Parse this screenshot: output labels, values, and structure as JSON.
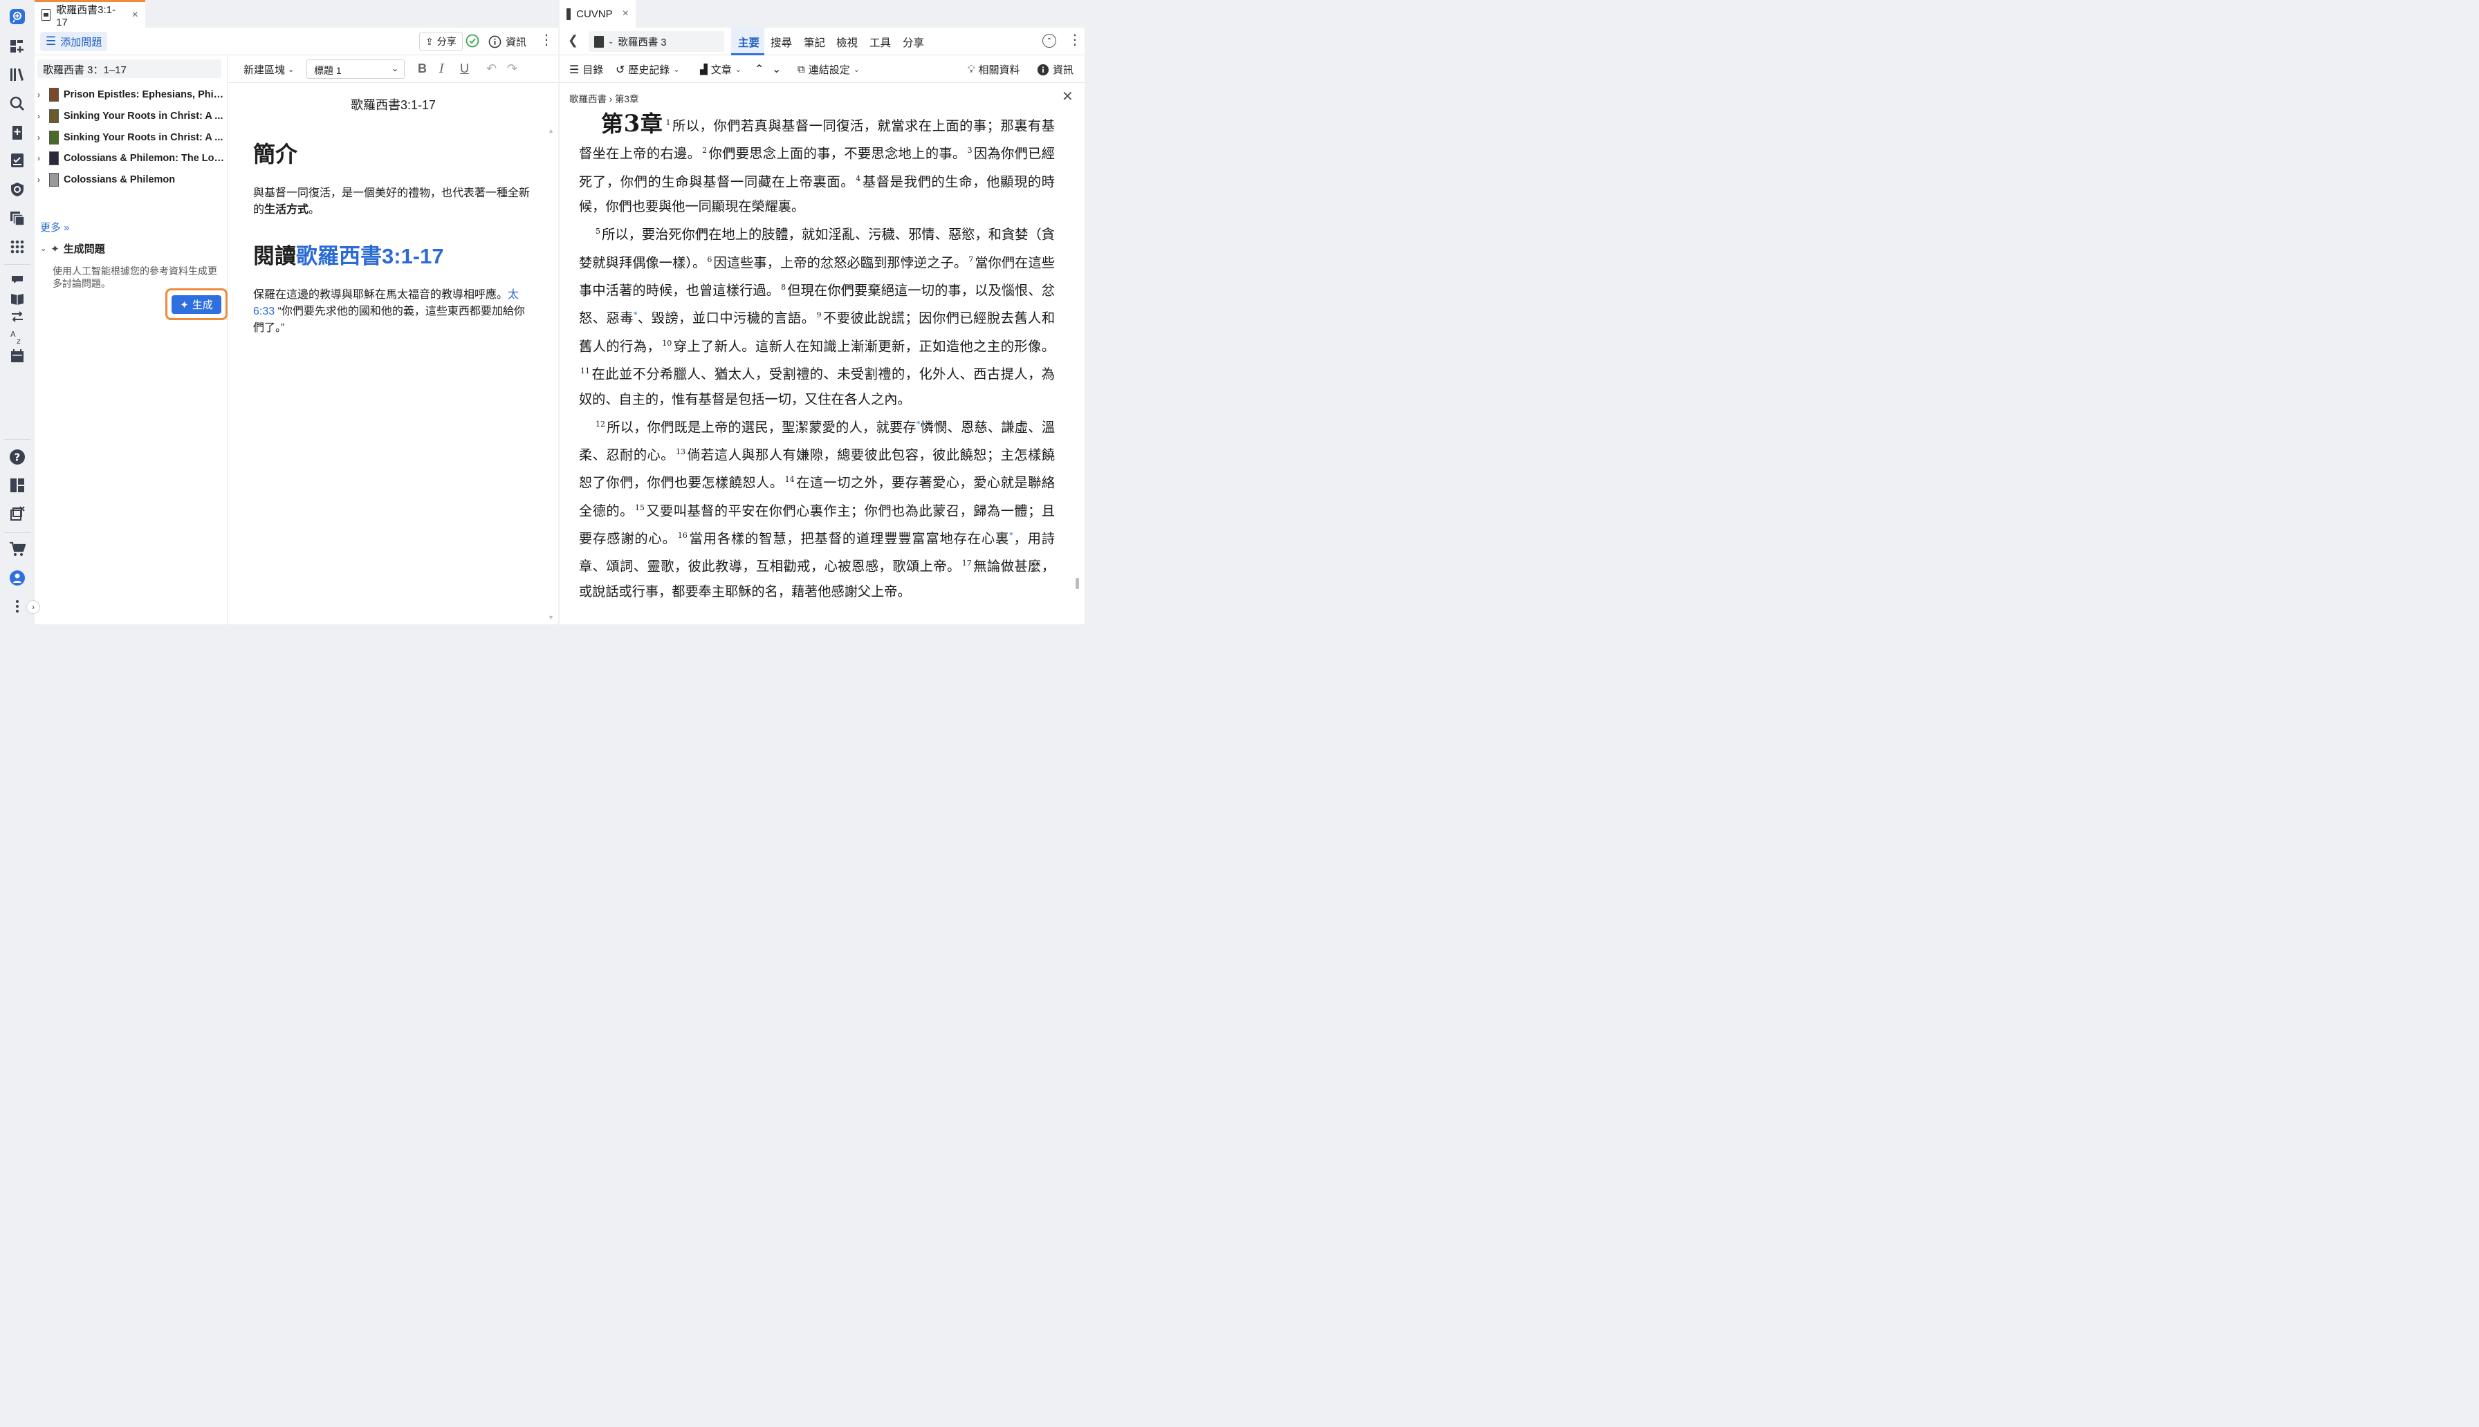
{
  "left_tab": {
    "title": "歌羅西書3:1-17",
    "close": "×"
  },
  "right_tab": {
    "title": "CUVNP",
    "close": "×"
  },
  "left_toolbar": {
    "add_question": "添加問題",
    "share": "分享",
    "info": "資訊"
  },
  "sidebar": {
    "passage": "歌羅西書 3：1–17",
    "resources": [
      {
        "label": "Prison Epistles: Ephesians, Phili...",
        "thumb_color": "#7a4a2a"
      },
      {
        "label": "Sinking Your Roots in Christ: A ...",
        "thumb_color": "#6b5a2a"
      },
      {
        "label": "Sinking Your Roots in Christ: A ...",
        "thumb_color": "#4a6a2a"
      },
      {
        "label": "Colossians & Philemon: The Lor...",
        "thumb_color": "#2a2a3a"
      },
      {
        "label": "Colossians & Philemon",
        "thumb_color": "#9a9a9a"
      }
    ],
    "more": "更多 »",
    "generate_heading": "生成問題",
    "generate_desc": "使用人工智能根據您的參考資料生成更多討論問題。",
    "generate_button": "生成"
  },
  "editor": {
    "block_menu": "新建區塊",
    "style_select": "標題 1",
    "title": "歌羅西書3:1-17",
    "h1": "簡介",
    "p1_start": "與基督一同復活，是一個美好的禮物，也代表著一種全新的",
    "p1_bold": "生活方式",
    "p1_end": "。",
    "h2_prefix": "閱讀",
    "h2_link": "歌羅西書3:1-17",
    "p2_start": "保羅在這邊的教導與耶穌在馬太福音的教導相呼應。",
    "p2_ref": "太6:33",
    "p2_end": " “你們要先求他的國和他的義，這些東西都要加給你們了。”"
  },
  "right_toolbar": {
    "book": "歌羅西書 3",
    "tabs": [
      "主要",
      "搜尋",
      "筆記",
      "檢視",
      "工具",
      "分享"
    ]
  },
  "right_toolbar2": {
    "toc": "目錄",
    "history": "歷史記錄",
    "text": "文章",
    "link_settings": "連結設定",
    "related": "相關資料",
    "info": "資訊"
  },
  "breadcrumb": {
    "book": "歌羅西書",
    "sep": "›",
    "chapter": "第3章"
  },
  "bible": {
    "chapter_label_pre": "第",
    "chapter_num": "3",
    "chapter_label_post": "章",
    "para1": [
      {
        "n": "1",
        "t": "所以，你們若真與基督一同復活，就當求在上面的事；那裏有基督坐在上帝的右邊。"
      },
      {
        "n": "2",
        "t": "你們要思念上面的事，不要思念地上的事。"
      },
      {
        "n": "3",
        "t": "因為你們已經死了，你們的生命與基督一同藏在上帝裏面。"
      },
      {
        "n": "4",
        "t": "基督是我們的生命，他顯現的時候，你們也要與他一同顯現在榮耀裏。"
      }
    ],
    "para2": [
      {
        "n": "5",
        "t": "所以，要治死你們在地上的肢體，就如淫亂、污穢、邪情、惡慾，和貪婪（貪婪就與拜偶像一樣）。"
      },
      {
        "n": "6",
        "t": "因這些事，上帝的忿怒必臨到那悖逆之子。"
      },
      {
        "n": "7",
        "t": "當你們在這些事中活著的時候，也曾這樣行過。"
      },
      {
        "n": "8",
        "t": "但現在你們要棄絕這一切的事，以及惱恨、忿怒、惡毒",
        "star": true,
        "t2": "、毀謗，並口中污穢的言語。"
      },
      {
        "n": "9",
        "t": "不要彼此說謊；因你們已經脫去舊人和舊人的行為，"
      },
      {
        "n": "10",
        "t": "穿上了新人。這新人在知識上漸漸更新，正如造他之主的形像。"
      },
      {
        "n": "11",
        "t": "在此並不分希臘人、猶太人，受割禮的、未受割禮的，化外人、西古提人，為奴的、自主的，惟有基督是包括一切，又住在各人之內。"
      }
    ],
    "para3": [
      {
        "n": "12",
        "t": "所以，你們既是上帝的選民，聖潔蒙愛的人，就要存",
        "star": true,
        "t2": "憐憫、恩慈、謙虛、溫柔、忍耐的心。"
      },
      {
        "n": "13",
        "t": "倘若這人與那人有嫌隙，總要彼此包容，彼此饒恕；主怎樣饒恕了你們，你們也要怎樣饒恕人。"
      },
      {
        "n": "14",
        "t": "在這一切之外，要存著愛心，愛心就是聯絡全德的。"
      },
      {
        "n": "15",
        "t": "又要叫基督的平安在你們心裏作主；你們也為此蒙召，歸為一體；且要存感謝的心。"
      },
      {
        "n": "16",
        "t": "當用各樣的智慧，把基督的道理豐豐富富地存在心裏",
        "star": true,
        "t2": "，用詩章、頌詞、靈歌，彼此教導，互相勸戒，心被恩感，歌頌上帝。"
      },
      {
        "n": "17",
        "t": "無論做甚麼，或說話或行事，都要奉主耶穌的名，藉著他感謝父上帝。"
      }
    ],
    "star": "*"
  },
  "colors": {
    "accent": "#2f6fe0",
    "highlight": "#f0893a",
    "link": "#2a6bd6"
  }
}
